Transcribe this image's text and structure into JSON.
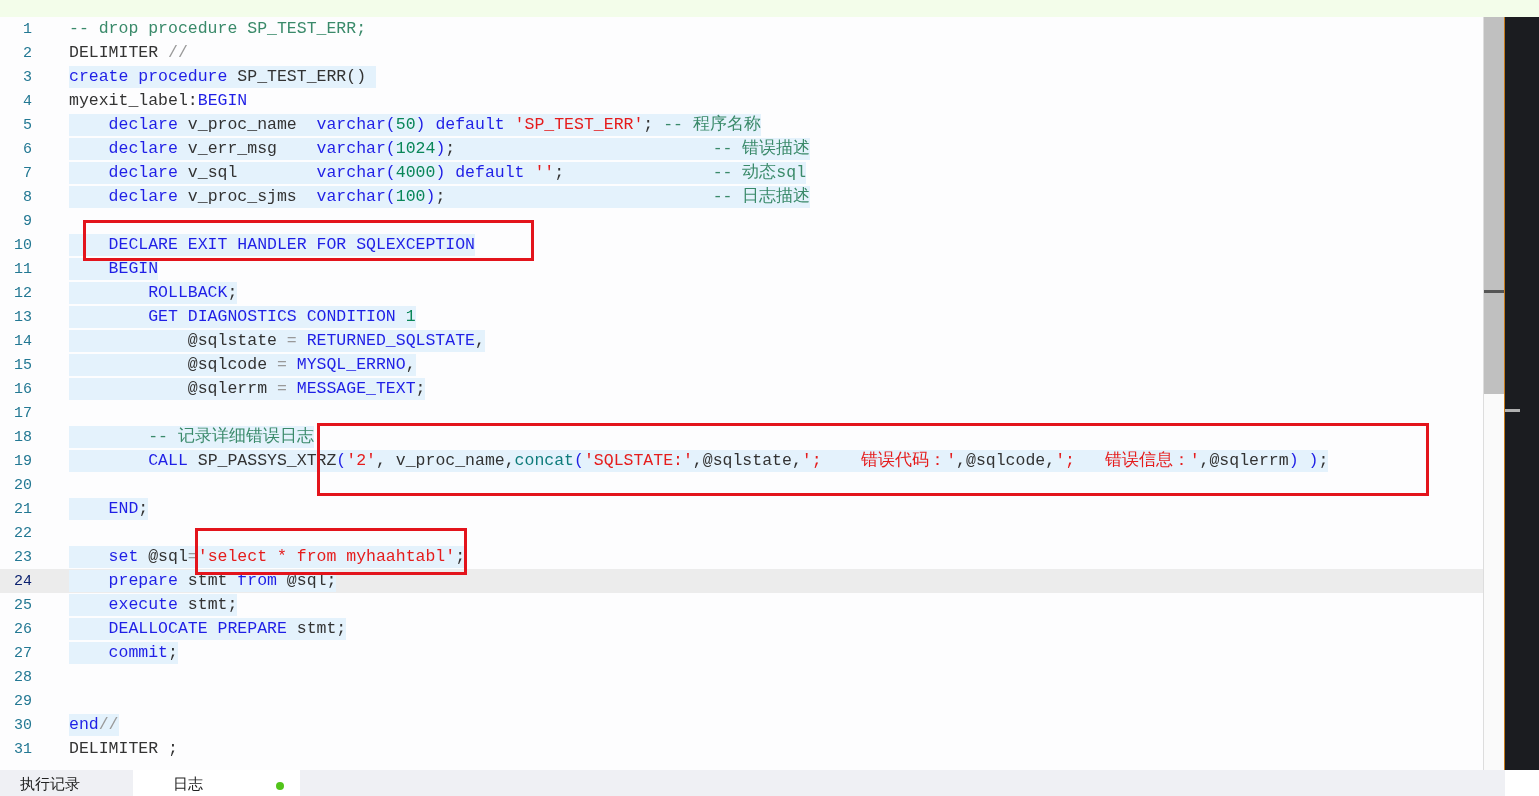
{
  "editor": {
    "lines": [
      {
        "number": "1",
        "highlighted": false,
        "current": false,
        "tokens": [
          {
            "text": "-- drop procedure SP_TEST_ERR;",
            "kind": "comment"
          }
        ]
      },
      {
        "number": "2",
        "highlighted": false,
        "current": false,
        "tokens": [
          {
            "text": "DELIMITER ",
            "kind": "ident"
          },
          {
            "text": "//",
            "kind": "operator"
          }
        ]
      },
      {
        "number": "3",
        "highlighted": true,
        "current": false,
        "tokens": [
          {
            "text": "create procedure",
            "kind": "keyword"
          },
          {
            "text": " SP_TEST_ERR() ",
            "kind": "ident"
          }
        ]
      },
      {
        "number": "4",
        "highlighted": false,
        "current": false,
        "tokens": [
          {
            "text": "myexit_label:",
            "kind": "ident"
          },
          {
            "text": "BEGIN",
            "kind": "keyword"
          }
        ]
      },
      {
        "number": "5",
        "highlighted": true,
        "current": false,
        "tokens": [
          {
            "text": "    declare",
            "kind": "keyword"
          },
          {
            "text": " v_proc_name  ",
            "kind": "ident"
          },
          {
            "text": "varchar(",
            "kind": "keyword"
          },
          {
            "text": "50",
            "kind": "number"
          },
          {
            "text": ") default ",
            "kind": "keyword"
          },
          {
            "text": "'SP_TEST_ERR'",
            "kind": "string"
          },
          {
            "text": "; ",
            "kind": "ident"
          },
          {
            "text": "-- 程序名称",
            "kind": "comment"
          }
        ]
      },
      {
        "number": "6",
        "highlighted": true,
        "current": false,
        "tokens": [
          {
            "text": "    declare",
            "kind": "keyword"
          },
          {
            "text": " v_err_msg    ",
            "kind": "ident"
          },
          {
            "text": "varchar(",
            "kind": "keyword"
          },
          {
            "text": "1024",
            "kind": "number"
          },
          {
            "text": ")",
            "kind": "keyword"
          },
          {
            "text": ";                          ",
            "kind": "ident"
          },
          {
            "text": "-- 错误描述",
            "kind": "comment"
          }
        ]
      },
      {
        "number": "7",
        "highlighted": true,
        "current": false,
        "tokens": [
          {
            "text": "    declare",
            "kind": "keyword"
          },
          {
            "text": " v_sql        ",
            "kind": "ident"
          },
          {
            "text": "varchar(",
            "kind": "keyword"
          },
          {
            "text": "4000",
            "kind": "number"
          },
          {
            "text": ") default ",
            "kind": "keyword"
          },
          {
            "text": "''",
            "kind": "string"
          },
          {
            "text": ";               ",
            "kind": "ident"
          },
          {
            "text": "-- 动态sql",
            "kind": "comment"
          }
        ]
      },
      {
        "number": "8",
        "highlighted": true,
        "current": false,
        "tokens": [
          {
            "text": "    declare",
            "kind": "keyword"
          },
          {
            "text": " v_proc_sjms  ",
            "kind": "ident"
          },
          {
            "text": "varchar(",
            "kind": "keyword"
          },
          {
            "text": "100",
            "kind": "number"
          },
          {
            "text": ")",
            "kind": "keyword"
          },
          {
            "text": ";                           ",
            "kind": "ident"
          },
          {
            "text": "-- 日志描述",
            "kind": "comment"
          }
        ]
      },
      {
        "number": "9",
        "highlighted": false,
        "current": false
      },
      {
        "number": "10",
        "highlighted": true,
        "current": false,
        "tokens": [
          {
            "text": "    DECLARE EXIT HANDLER FOR SQLEXCEPTION",
            "kind": "keyword"
          }
        ]
      },
      {
        "number": "11",
        "highlighted": true,
        "current": false,
        "tokens": [
          {
            "text": "    BEGIN",
            "kind": "keyword"
          }
        ]
      },
      {
        "number": "12",
        "highlighted": true,
        "current": false,
        "tokens": [
          {
            "text": "        ROLLBACK",
            "kind": "keyword"
          },
          {
            "text": ";",
            "kind": "ident"
          }
        ]
      },
      {
        "number": "13",
        "highlighted": true,
        "current": false,
        "tokens": [
          {
            "text": "        GET DIAGNOSTICS CONDITION ",
            "kind": "keyword"
          },
          {
            "text": "1",
            "kind": "number"
          }
        ]
      },
      {
        "number": "14",
        "highlighted": true,
        "current": false,
        "tokens": [
          {
            "text": "            @sqlstate ",
            "kind": "ident"
          },
          {
            "text": "=",
            "kind": "operator"
          },
          {
            "text": " RETURNED_SQLSTATE",
            "kind": "keyword"
          },
          {
            "text": ",",
            "kind": "ident"
          }
        ]
      },
      {
        "number": "15",
        "highlighted": true,
        "current": false,
        "tokens": [
          {
            "text": "            @sqlcode ",
            "kind": "ident"
          },
          {
            "text": "=",
            "kind": "operator"
          },
          {
            "text": " MYSQL_ERRNO",
            "kind": "keyword"
          },
          {
            "text": ",",
            "kind": "ident"
          }
        ]
      },
      {
        "number": "16",
        "highlighted": true,
        "current": false,
        "tokens": [
          {
            "text": "            @sqlerrm ",
            "kind": "ident"
          },
          {
            "text": "=",
            "kind": "operator"
          },
          {
            "text": " MESSAGE_TEXT",
            "kind": "keyword"
          },
          {
            "text": ";",
            "kind": "ident"
          }
        ]
      },
      {
        "number": "17",
        "highlighted": false,
        "current": false
      },
      {
        "number": "18",
        "highlighted": true,
        "current": false,
        "tokens": [
          {
            "text": "        -- 记录详细错误日志",
            "kind": "comment"
          }
        ]
      },
      {
        "number": "19",
        "highlighted": true,
        "current": false,
        "tokens": [
          {
            "text": "        CALL",
            "kind": "keyword"
          },
          {
            "text": " SP_PASSYS_XTRZ",
            "kind": "ident"
          },
          {
            "text": "(",
            "kind": "keyword"
          },
          {
            "text": "'2'",
            "kind": "string"
          },
          {
            "text": ", v_proc_name,",
            "kind": "ident"
          },
          {
            "text": "concat",
            "kind": "function"
          },
          {
            "text": "(",
            "kind": "keyword"
          },
          {
            "text": "'SQLSTATE:'",
            "kind": "string"
          },
          {
            "text": ",@sqlstate,",
            "kind": "ident"
          },
          {
            "text": "';    错误代码：'",
            "kind": "string"
          },
          {
            "text": ",@sqlcode,",
            "kind": "ident"
          },
          {
            "text": "';   错误信息：'",
            "kind": "string"
          },
          {
            "text": ",@sqlerrm",
            "kind": "ident"
          },
          {
            "text": ") )",
            "kind": "keyword"
          },
          {
            "text": ";",
            "kind": "ident"
          }
        ]
      },
      {
        "number": "20",
        "highlighted": false,
        "current": false
      },
      {
        "number": "21",
        "highlighted": true,
        "current": false,
        "tokens": [
          {
            "text": "    END",
            "kind": "keyword"
          },
          {
            "text": ";",
            "kind": "ident"
          }
        ]
      },
      {
        "number": "22",
        "highlighted": false,
        "current": false
      },
      {
        "number": "23",
        "highlighted": true,
        "current": false,
        "tokens": [
          {
            "text": "    set",
            "kind": "keyword"
          },
          {
            "text": " @sql",
            "kind": "ident"
          },
          {
            "text": "=",
            "kind": "operator"
          },
          {
            "text": "'select * from myhaahtabl'",
            "kind": "string"
          },
          {
            "text": ";",
            "kind": "ident"
          }
        ]
      },
      {
        "number": "24",
        "highlighted": true,
        "current": true,
        "tokens": [
          {
            "text": "    prepare",
            "kind": "keyword"
          },
          {
            "text": " stmt ",
            "kind": "ident"
          },
          {
            "text": "from",
            "kind": "keyword"
          },
          {
            "text": " @sql;",
            "kind": "ident"
          }
        ]
      },
      {
        "number": "25",
        "highlighted": true,
        "current": false,
        "tokens": [
          {
            "text": "    execute",
            "kind": "keyword"
          },
          {
            "text": " stmt;",
            "kind": "ident"
          }
        ]
      },
      {
        "number": "26",
        "highlighted": true,
        "current": false,
        "tokens": [
          {
            "text": "    DEALLOCATE PREPARE",
            "kind": "keyword"
          },
          {
            "text": " stmt;",
            "kind": "ident"
          }
        ]
      },
      {
        "number": "27",
        "highlighted": true,
        "current": false,
        "tokens": [
          {
            "text": "    commit",
            "kind": "keyword"
          },
          {
            "text": ";",
            "kind": "ident"
          }
        ]
      },
      {
        "number": "28",
        "highlighted": false,
        "current": false
      },
      {
        "number": "29",
        "highlighted": false,
        "current": false
      },
      {
        "number": "30",
        "highlighted": true,
        "current": false,
        "tokens": [
          {
            "text": "end",
            "kind": "keyword"
          },
          {
            "text": "//",
            "kind": "operator"
          }
        ]
      },
      {
        "number": "31",
        "highlighted": false,
        "current": false,
        "tokens": [
          {
            "text": "DELIMITER ;",
            "kind": "ident"
          }
        ]
      }
    ]
  },
  "bottom_tabs": [
    {
      "label": "执行记录",
      "selected": false,
      "dot": false
    },
    {
      "label": "日志",
      "selected": true,
      "dot": true
    }
  ]
}
